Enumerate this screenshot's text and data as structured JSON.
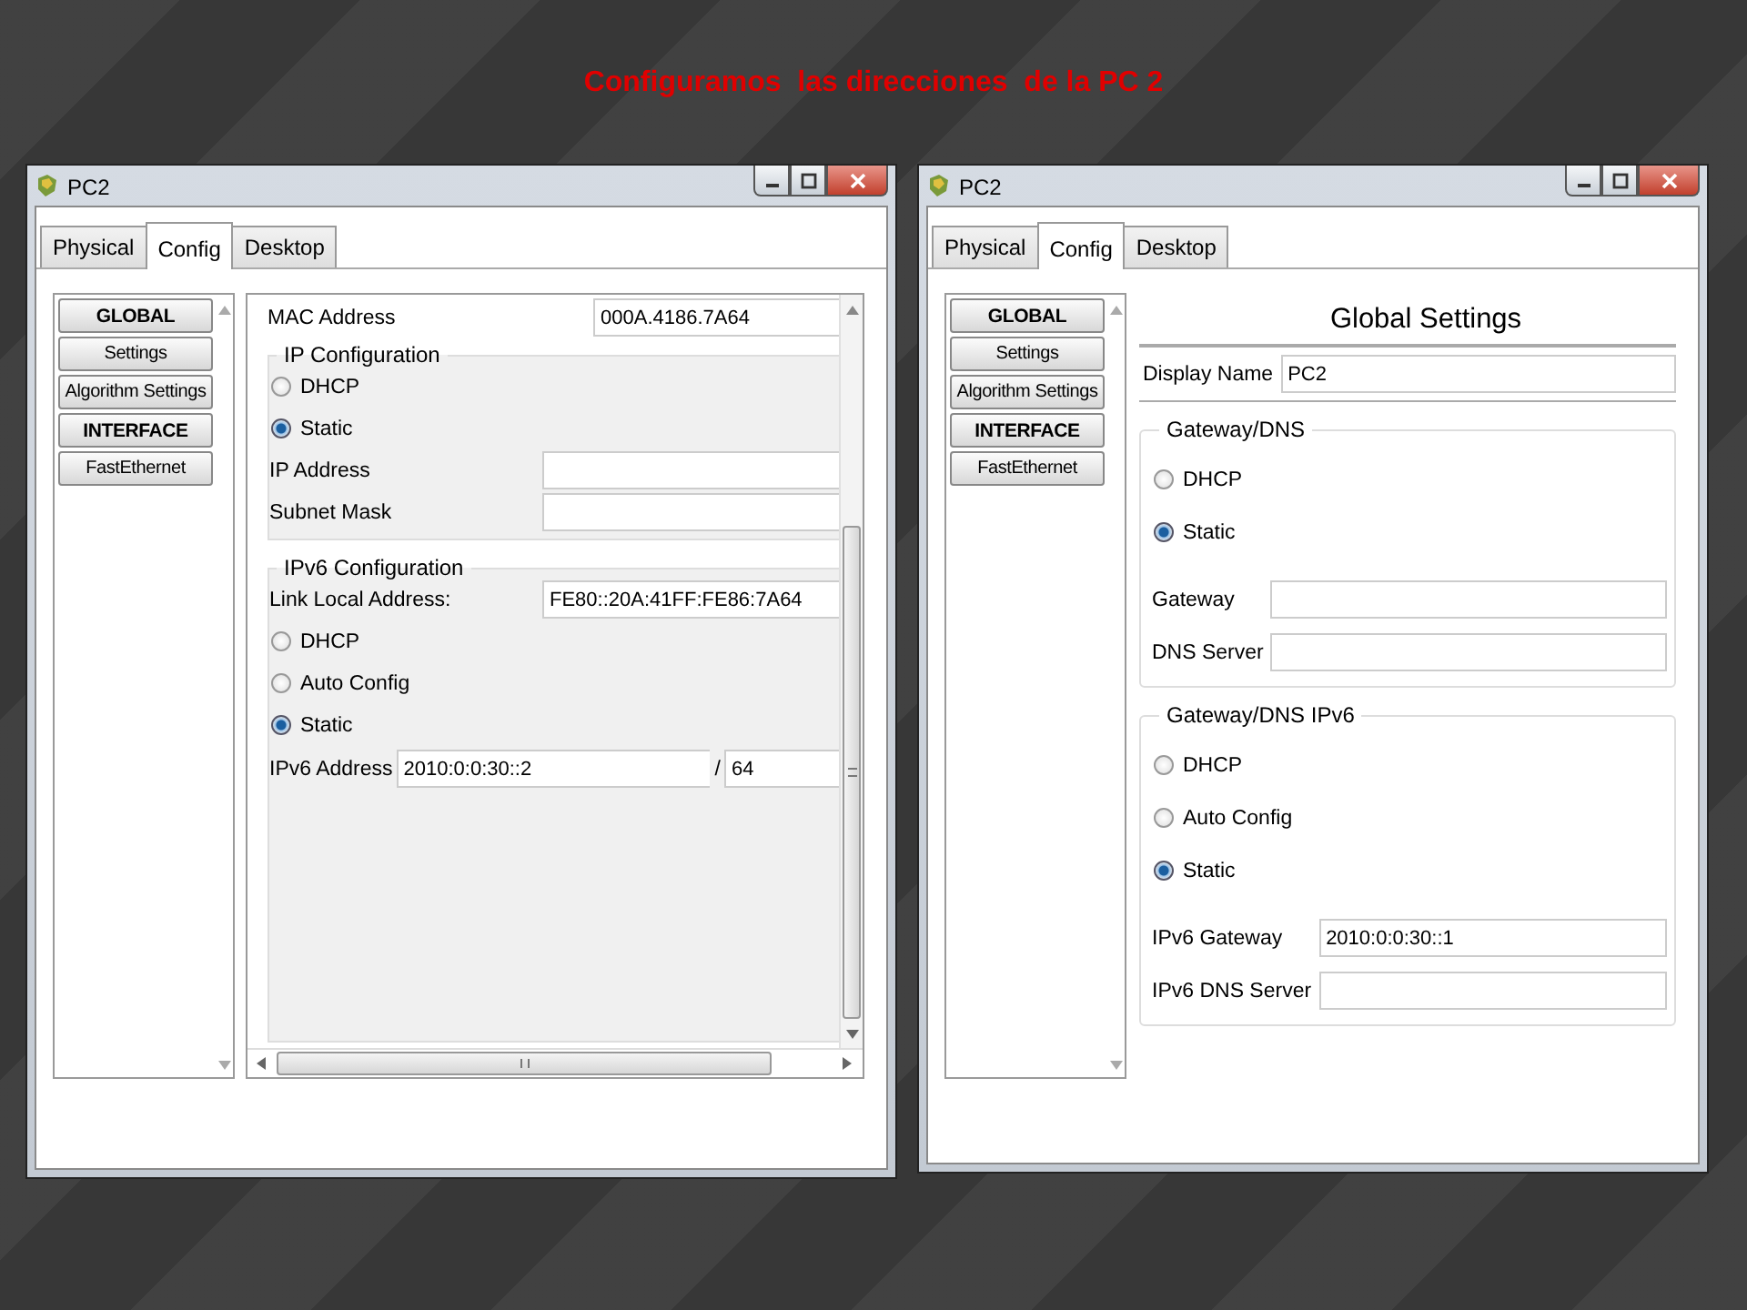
{
  "title": "Configuramos  las direcciones  de la PC 2",
  "windows": [
    {
      "title": "PC2",
      "scrollable": true,
      "tabs": [
        {
          "label": "Physical",
          "selected": false
        },
        {
          "label": "Config",
          "selected": true
        },
        {
          "label": "Desktop",
          "selected": false
        }
      ],
      "sidebar": [
        {
          "label": "GLOBAL",
          "kind": "header"
        },
        {
          "label": "Settings",
          "kind": "item"
        },
        {
          "label": "Algorithm Settings",
          "kind": "item"
        },
        {
          "label": "INTERFACE",
          "kind": "header"
        },
        {
          "label": "FastEthernet",
          "kind": "item"
        }
      ],
      "content": [
        {
          "kind": "field",
          "label": "MAC Address",
          "value": "000A.4186.7A64"
        },
        {
          "kind": "group",
          "title": "IP Configuration",
          "items": [
            {
              "kind": "radio",
              "label": "DHCP",
              "selected": false
            },
            {
              "kind": "radio",
              "label": "Static",
              "selected": true
            },
            {
              "kind": "field",
              "label": "IP Address"
            },
            {
              "kind": "field",
              "label": "Subnet Mask"
            }
          ]
        },
        {
          "kind": "group",
          "title": "IPv6 Configuration",
          "items": [
            {
              "kind": "field",
              "label": "Link Local Address:",
              "value": "FE80::20A:41FF:FE86:7A64"
            },
            {
              "kind": "radio",
              "label": "DHCP",
              "selected": false
            },
            {
              "kind": "radio",
              "label": "Auto Config",
              "selected": false
            },
            {
              "kind": "radio",
              "label": "Static",
              "selected": true
            },
            {
              "kind": "prefix_field",
              "label": "IPv6 Address",
              "value": "2010:0:0:30::2",
              "separator": "/",
              "prefix": "64"
            }
          ]
        }
      ]
    },
    {
      "title": "PC2",
      "scrollable": false,
      "tabs": [
        {
          "label": "Physical",
          "selected": false
        },
        {
          "label": "Config",
          "selected": true
        },
        {
          "label": "Desktop",
          "selected": false
        }
      ],
      "sidebar": [
        {
          "label": "GLOBAL",
          "kind": "header"
        },
        {
          "label": "Settings",
          "kind": "item"
        },
        {
          "label": "Algorithm Settings",
          "kind": "item"
        },
        {
          "label": "INTERFACE",
          "kind": "header"
        },
        {
          "label": "FastEthernet",
          "kind": "item"
        }
      ],
      "content": [
        {
          "kind": "heading",
          "label": "Global Settings"
        },
        {
          "kind": "field",
          "label": "Display Name",
          "value": "PC2"
        },
        {
          "kind": "group",
          "title": "Gateway/DNS",
          "items": [
            {
              "kind": "radio",
              "label": "DHCP",
              "selected": false
            },
            {
              "kind": "radio",
              "label": "Static",
              "selected": true
            },
            {
              "kind": "field",
              "label": "Gateway"
            },
            {
              "kind": "field",
              "label": "DNS Server"
            }
          ]
        },
        {
          "kind": "group",
          "title": "Gateway/DNS IPv6",
          "items": [
            {
              "kind": "radio",
              "label": "DHCP",
              "selected": false
            },
            {
              "kind": "radio",
              "label": "Auto Config",
              "selected": false
            },
            {
              "kind": "radio",
              "label": "Static",
              "selected": true
            },
            {
              "kind": "field",
              "label": "IPv6 Gateway",
              "value": "2010:0:0:30::1"
            },
            {
              "kind": "field",
              "label": "IPv6 DNS Server"
            }
          ]
        }
      ]
    }
  ]
}
